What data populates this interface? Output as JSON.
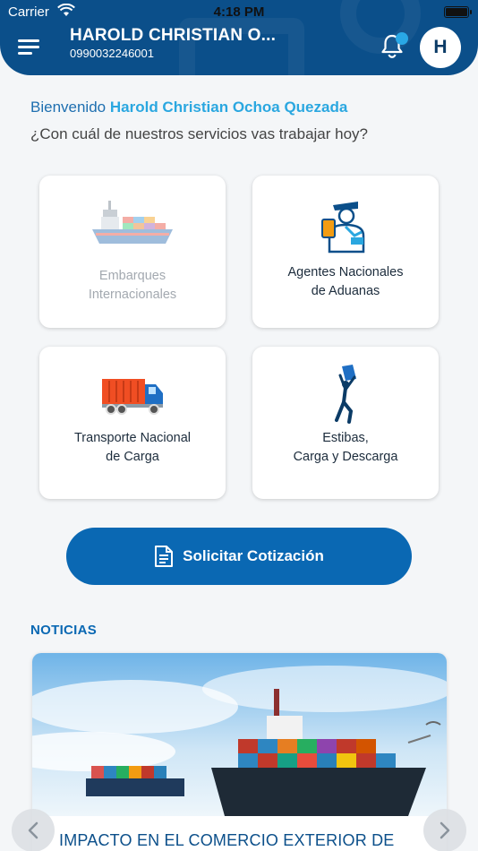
{
  "status_bar": {
    "carrier": "Carrier",
    "time": "4:18 PM"
  },
  "header": {
    "user_name": "HAROLD CHRISTIAN O...",
    "user_id": "0990032246001",
    "avatar_initial": "H"
  },
  "welcome": {
    "greeting": "Bienvenido",
    "name": "Harold Christian Ochoa Quezada",
    "question": "¿Con cuál de nuestros servicios vas trabajar hoy?"
  },
  "services": [
    {
      "line1": "Embarques",
      "line2": "Internacionales",
      "icon": "cargo-ship-icon",
      "enabled": false
    },
    {
      "line1": "Agentes Nacionales",
      "line2": "de Aduanas",
      "icon": "customs-agent-icon",
      "enabled": true
    },
    {
      "line1": "Transporte Nacional",
      "line2": "de Carga",
      "icon": "truck-icon",
      "enabled": true
    },
    {
      "line1": "Estibas,",
      "line2": "Carga y Descarga",
      "icon": "stevedore-icon",
      "enabled": true
    }
  ],
  "cta": {
    "label": "Solicitar Cotización"
  },
  "news": {
    "section_title": "NOTICIAS",
    "headline": "IMPACTO EN EL COMERCIO EXTERIOR DE"
  },
  "colors": {
    "header": "#0b4f8a",
    "accent": "#2aa7e0",
    "primary_button": "#0a68b3",
    "notification_dot": "#29a8e6"
  }
}
